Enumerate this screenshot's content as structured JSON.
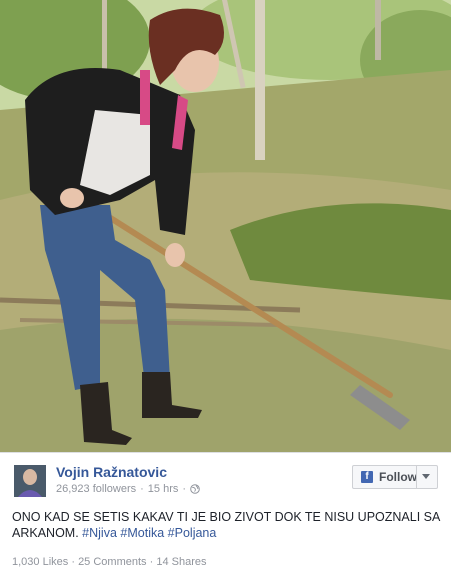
{
  "post": {
    "author": "Vojin Ražnatovic",
    "followers": "26,923 followers",
    "separator": "·",
    "time": "15 hrs",
    "separator2": "·",
    "follow_label": "Follow",
    "text": "ONO KAD SE SETIS KAKAV TI JE BIO ZIVOT DOK TE NISU UPOZNALI SA ARKANOM.",
    "hashtags": [
      "#Njiva",
      "#Motika",
      "#Poljana"
    ],
    "likes": "1,030 Likes",
    "comments": "25 Comments",
    "shares": "14 Shares",
    "stats_sep": "·"
  },
  "icons": {
    "privacy": "globe-icon",
    "follow": "facebook-f-icon",
    "menu": "chevron-down-icon"
  },
  "colors": {
    "link": "#365899",
    "meta": "#90949c",
    "fb_blue": "#4267b2"
  }
}
